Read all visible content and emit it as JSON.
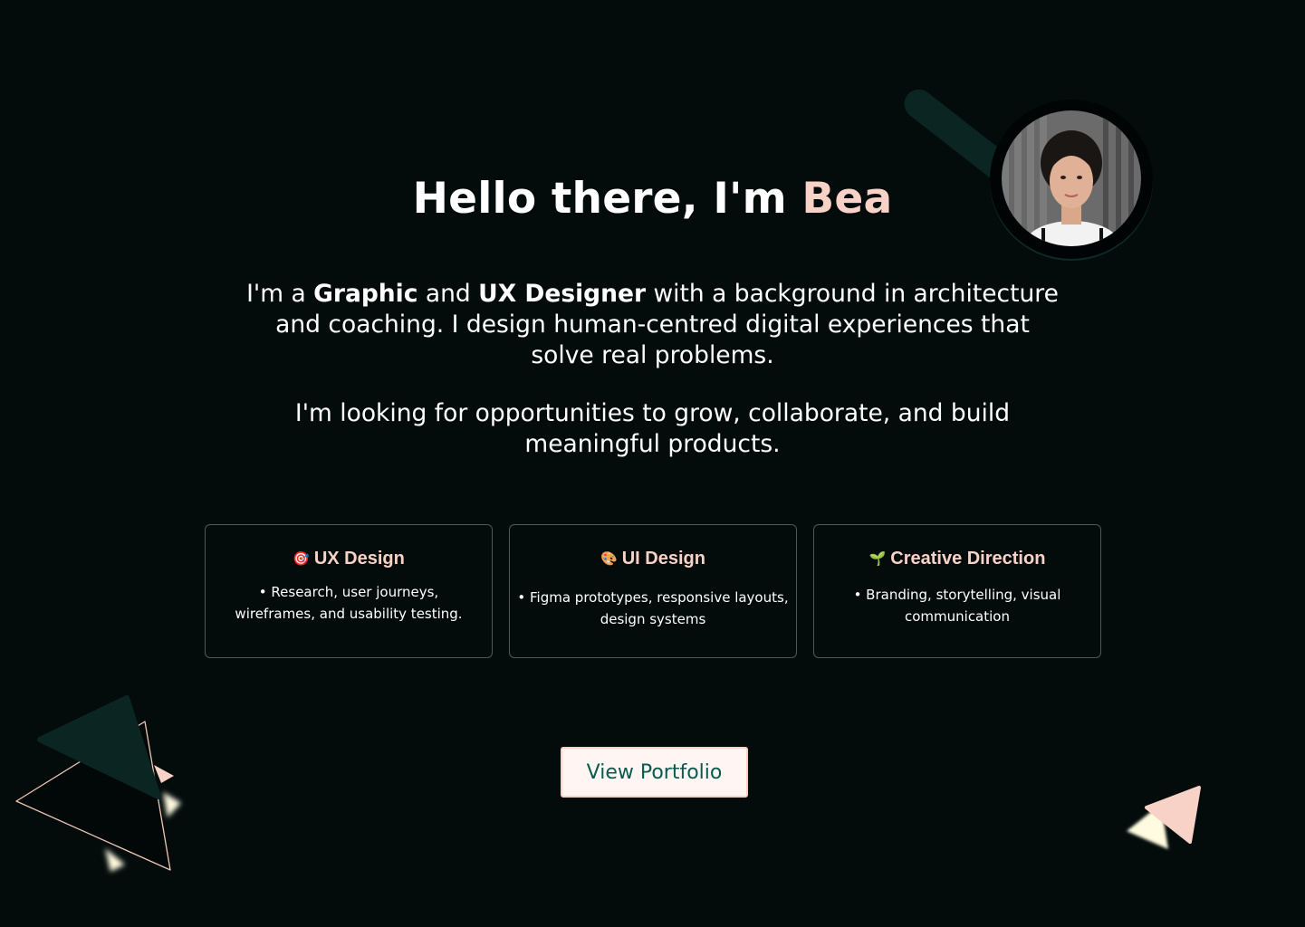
{
  "hero": {
    "greeting": "Hello there, I'm ",
    "name": "Bea",
    "intro": {
      "p1": "I'm a ",
      "role1": "Graphic",
      "p2": " and ",
      "role2": "UX Designer",
      "p3": " with a background in architecture and coaching. I design human-centred digital experiences that solve real problems."
    },
    "intro2": "I'm looking for opportunities to grow, collaborate, and build meaningful products."
  },
  "cards": [
    {
      "emoji": "🎯",
      "title": "UX Design",
      "desc": "• Research, user journeys, wireframes, and usability testing."
    },
    {
      "emoji": "🎨",
      "title": "UI Design",
      "desc": "• Figma prototypes, responsive layouts, design systems"
    },
    {
      "emoji": "🌱",
      "title": "Creative Direction",
      "desc": "• Branding, storytelling, visual communication"
    }
  ],
  "cta": {
    "label": "View Portfolio"
  },
  "colors": {
    "background": "#030c0b",
    "accent": "#f8d2c6",
    "dark_green": "#0b2622",
    "button_text": "#0a5a50"
  }
}
